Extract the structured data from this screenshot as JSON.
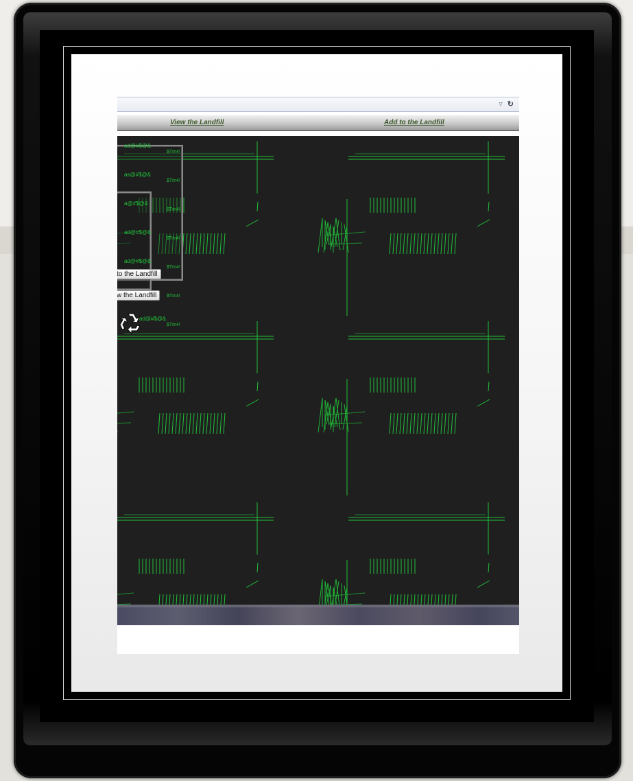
{
  "browser": {
    "url_value": "",
    "dropdown_icon": "triangle-down",
    "reload_icon": "reload"
  },
  "nav": {
    "view_label": "View the Landfill",
    "add_label": "Add to the Landfill"
  },
  "overlay": {
    "menu_line_1": "ad@#$@&",
    "menu_line_2": "as@#$@&",
    "menu_line_3": "a@#$@&",
    "menu_line_4": "ad@#$@&",
    "menu_line_5": "ad@#$@&",
    "menu_line_6": "ad@#$@&",
    "menu_line_7": "ad@#$@&",
    "side_tag": "$Tm4!",
    "add_button_label": "to the Landfill",
    "view_button_label": "w the Landfill"
  },
  "colors": {
    "glitch_green": "#21c23a",
    "canvas_bg": "#1f1f1f",
    "nav_link": "#3d5a2b"
  }
}
